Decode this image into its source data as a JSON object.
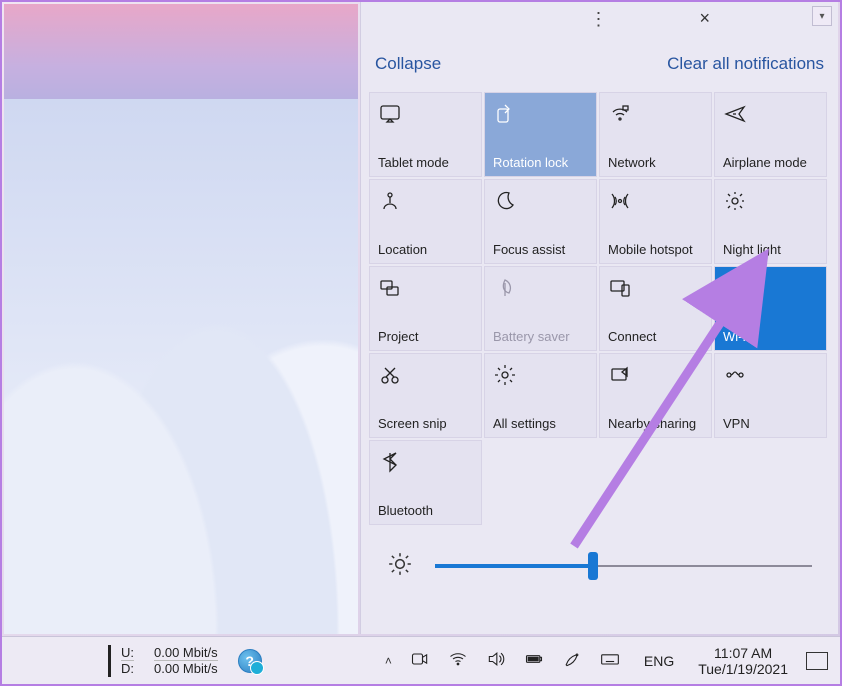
{
  "action_center": {
    "collapse": "Collapse",
    "clear_all": "Clear all notifications",
    "tiles": [
      {
        "id": "tablet-mode",
        "label": "Tablet mode",
        "icon": "tablet-icon",
        "state": "normal"
      },
      {
        "id": "rotation-lock",
        "label": "Rotation lock",
        "icon": "rotation-icon",
        "state": "selected"
      },
      {
        "id": "network",
        "label": "Network",
        "icon": "wifi-mini-icon",
        "state": "normal"
      },
      {
        "id": "airplane-mode",
        "label": "Airplane mode",
        "icon": "airplane-icon",
        "state": "normal"
      },
      {
        "id": "location",
        "label": "Location",
        "icon": "location-icon",
        "state": "normal"
      },
      {
        "id": "focus-assist",
        "label": "Focus assist",
        "icon": "moon-icon",
        "state": "normal"
      },
      {
        "id": "mobile-hotspot",
        "label": "Mobile hotspot",
        "icon": "hotspot-icon",
        "state": "normal"
      },
      {
        "id": "night-light",
        "label": "Night light",
        "icon": "sun-icon",
        "state": "normal"
      },
      {
        "id": "project",
        "label": "Project",
        "icon": "project-icon",
        "state": "normal"
      },
      {
        "id": "battery-saver",
        "label": "Battery saver",
        "icon": "leaf-icon",
        "state": "disabled"
      },
      {
        "id": "connect",
        "label": "Connect",
        "icon": "connect-icon",
        "state": "normal"
      },
      {
        "id": "wifi",
        "label": "Wi-Fi",
        "icon": "wifi-icon",
        "state": "active"
      },
      {
        "id": "screen-snip",
        "label": "Screen snip",
        "icon": "snip-icon",
        "state": "normal"
      },
      {
        "id": "all-settings",
        "label": "All settings",
        "icon": "gear-icon",
        "state": "normal"
      },
      {
        "id": "nearby-sharing",
        "label": "Nearby sharing",
        "icon": "share-icon",
        "state": "normal"
      },
      {
        "id": "vpn",
        "label": "VPN",
        "icon": "vpn-icon",
        "state": "normal"
      },
      {
        "id": "bluetooth",
        "label": "Bluetooth",
        "icon": "bluetooth-icon",
        "state": "normal"
      }
    ],
    "brightness_percent": 42
  },
  "taskbar": {
    "net": {
      "u_label": "U:",
      "u_value": "0.00 Mbit/s",
      "d_label": "D:",
      "d_value": "0.00 Mbit/s"
    },
    "lang": "ENG",
    "time": "11:07 AM",
    "date": "Tue/1/19/2021"
  },
  "annotation": {
    "target_tile": "night-light"
  },
  "colors": {
    "accent": "#1978d4",
    "selected": "#8aa8d8",
    "annotation": "#b57ee3"
  }
}
